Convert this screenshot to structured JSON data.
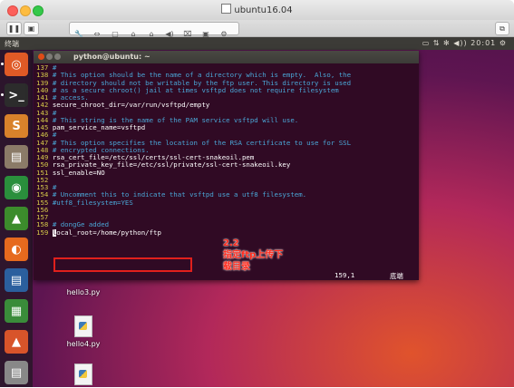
{
  "host_window": {
    "title": "ubuntu16.04",
    "toolbar": {
      "pause_label": "❚❚",
      "snapshot_label": "▣",
      "tools": [
        "🔧",
        "⇔",
        "▢",
        "⌂",
        "⌂",
        "◀)",
        "⌧",
        "▣",
        "⚙",
        "◀"
      ],
      "right_label": "⧉"
    }
  },
  "ubuntu_panel": {
    "app_name": "终端",
    "tray_time": "20:01",
    "tray_icons": "▭ ⇅ ✻ ◀)) 20:01 ⚙"
  },
  "launcher": {
    "items": [
      {
        "name": "dash",
        "glyph": "◎",
        "color": "#e05a26"
      },
      {
        "name": "terminal",
        "glyph": ">_",
        "color": "#2c2c2c"
      },
      {
        "name": "sublime",
        "glyph": "S",
        "color": "#d9822b"
      },
      {
        "name": "files",
        "glyph": "▤",
        "color": "#8b7b68"
      },
      {
        "name": "chrome",
        "glyph": "◉",
        "color": "#2a8f3c"
      },
      {
        "name": "pycharm",
        "glyph": "▲",
        "color": "#3c8c2c"
      },
      {
        "name": "firefox",
        "glyph": "◐",
        "color": "#e66a1e"
      },
      {
        "name": "writer",
        "glyph": "▤",
        "color": "#2b5f9e"
      },
      {
        "name": "calc",
        "glyph": "▦",
        "color": "#3a8c3a"
      },
      {
        "name": "impress",
        "glyph": "▲",
        "color": "#d8542a"
      },
      {
        "name": "trash",
        "glyph": "▤",
        "color": "#888888"
      }
    ]
  },
  "desktop_files": [
    {
      "name": "hello3.py"
    },
    {
      "name": "hello4.py"
    },
    {
      "name": ""
    }
  ],
  "terminal": {
    "title": "python@ubuntu: ~",
    "lines": [
      {
        "n": "137",
        "text": "#",
        "kind": "comment"
      },
      {
        "n": "138",
        "text": "# This option should be the name of a directory which is empty.  Also, the",
        "kind": "comment"
      },
      {
        "n": "139",
        "text": "# directory should not be writable by the ftp user. This directory is used",
        "kind": "comment"
      },
      {
        "n": "140",
        "text": "# as a secure chroot() jail at times vsftpd does not require filesystem",
        "kind": "comment"
      },
      {
        "n": "141",
        "text": "# access.",
        "kind": "comment"
      },
      {
        "n": "142",
        "text": "secure_chroot_dir=/var/run/vsftpd/empty",
        "kind": "code"
      },
      {
        "n": "143",
        "text": "#",
        "kind": "comment"
      },
      {
        "n": "144",
        "text": "# This string is the name of the PAM service vsftpd will use.",
        "kind": "comment"
      },
      {
        "n": "145",
        "text": "pam_service_name=vsftpd",
        "kind": "code"
      },
      {
        "n": "146",
        "text": "#",
        "kind": "comment"
      },
      {
        "n": "147",
        "text": "# This option specifies the location of the RSA certificate to use for SSL",
        "kind": "comment"
      },
      {
        "n": "148",
        "text": "# encrypted connections.",
        "kind": "comment"
      },
      {
        "n": "149",
        "text": "rsa_cert_file=/etc/ssl/certs/ssl-cert-snakeoil.pem",
        "kind": "code"
      },
      {
        "n": "150",
        "text": "rsa_private_key_file=/etc/ssl/private/ssl-cert-snakeoil.key",
        "kind": "code"
      },
      {
        "n": "151",
        "text": "ssl_enable=NO",
        "kind": "code"
      },
      {
        "n": "152",
        "text": "",
        "kind": "code"
      },
      {
        "n": "153",
        "text": "#",
        "kind": "comment"
      },
      {
        "n": "154",
        "text": "# Uncomment this to indicate that vsftpd use a utf8 filesystem.",
        "kind": "comment"
      },
      {
        "n": "155",
        "text": "#utf8_filesystem=YES",
        "kind": "comment"
      },
      {
        "n": "156",
        "text": "",
        "kind": "code"
      },
      {
        "n": "157",
        "text": "",
        "kind": "code"
      },
      {
        "n": "158",
        "text": "# dongGe added",
        "kind": "comment"
      },
      {
        "n": "159",
        "text": "local_root=/home/python/ftp",
        "kind": "cursor"
      }
    ],
    "status_position": "159,1",
    "status_scroll": "底端"
  },
  "annotation": {
    "text": "2.2\n指定ftp上传下\n载目录",
    "color": "#ff2a1c"
  }
}
